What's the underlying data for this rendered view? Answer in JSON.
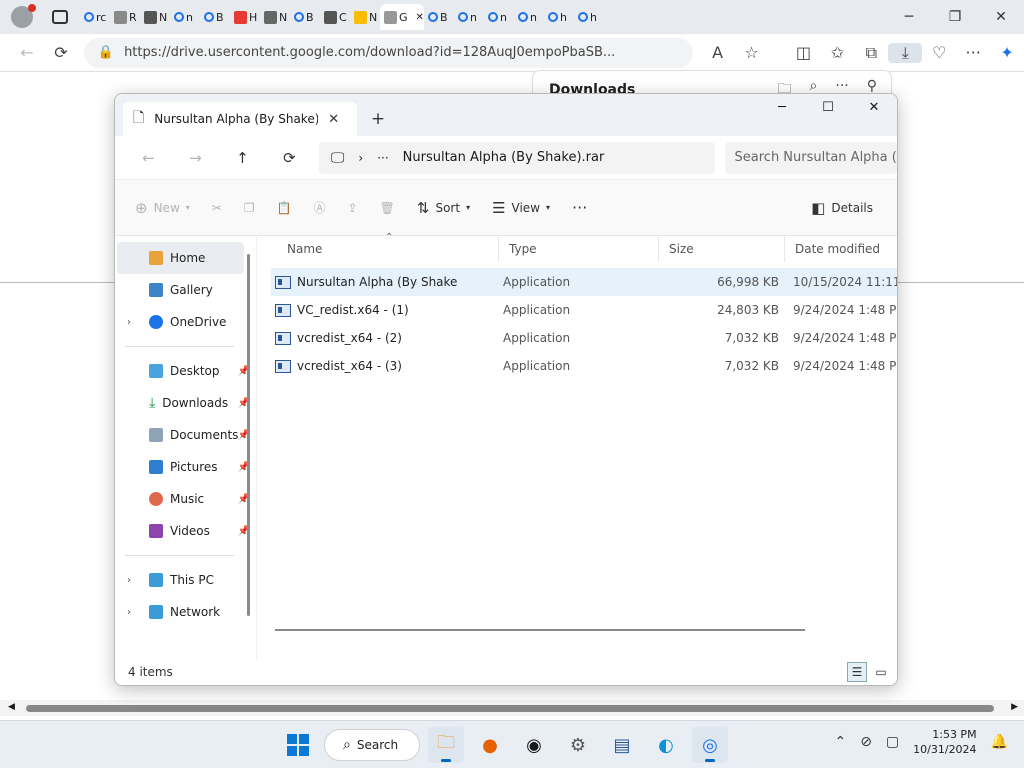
{
  "browser": {
    "tabs": [
      {
        "title": "rc",
        "icon": "search-icon"
      },
      {
        "title": "R",
        "icon": "image-icon"
      },
      {
        "title": "N",
        "icon": "news-icon"
      },
      {
        "title": "n",
        "icon": "search-icon"
      },
      {
        "title": "B",
        "icon": "search-icon"
      },
      {
        "title": "H",
        "icon": "youtube-icon"
      },
      {
        "title": "N",
        "icon": "document-icon"
      },
      {
        "title": "B",
        "icon": "search-icon"
      },
      {
        "title": "C",
        "icon": "speaker-icon"
      },
      {
        "title": "N",
        "icon": "google-drive-icon"
      },
      {
        "title": "G",
        "icon": "loading-icon",
        "active": true
      },
      {
        "title": "B",
        "icon": "search-icon"
      },
      {
        "title": "n",
        "icon": "search-icon"
      },
      {
        "title": "n",
        "icon": "search-icon"
      },
      {
        "title": "n",
        "icon": "search-icon"
      },
      {
        "title": "h",
        "icon": "search-icon"
      },
      {
        "title": "h",
        "icon": "search-icon"
      }
    ],
    "address_url": "https://drive.usercontent.google.com/download?id=128AuqJ0empoPbaSB...",
    "downloads_panel_title": "Downloads"
  },
  "explorer": {
    "tab_title": "Nursultan Alpha (By Shake).rar",
    "breadcrumb_more": "···",
    "breadcrumb_path": "Nursultan Alpha (By Shake).rar",
    "search_placeholder": "Search Nursultan Alpha (",
    "commands": {
      "new": "New",
      "sort": "Sort",
      "view": "View",
      "more": "···",
      "details": "Details"
    },
    "columns": {
      "name": "Name",
      "type": "Type",
      "size": "Size",
      "date": "Date modified"
    },
    "files": [
      {
        "name": "Nursultan Alpha (By Shake",
        "type": "Application",
        "size": "66,998 KB",
        "date": "10/15/2024 11:11"
      },
      {
        "name": "VC_redist.x64 - (1)",
        "type": "Application",
        "size": "24,803 KB",
        "date": "9/24/2024 1:48 PM"
      },
      {
        "name": "vcredist_x64  - (2)",
        "type": "Application",
        "size": "7,032 KB",
        "date": "9/24/2024 1:48 PM"
      },
      {
        "name": "vcredist_x64 - (3)",
        "type": "Application",
        "size": "7,032 KB",
        "date": "9/24/2024 1:48 PM"
      }
    ],
    "nav": {
      "home": "Home",
      "gallery": "Gallery",
      "onedrive": "OneDrive",
      "desktop": "Desktop",
      "downloads": "Downloads",
      "documents": "Documents",
      "pictures": "Pictures",
      "music": "Music",
      "videos": "Videos",
      "thispc": "This PC",
      "network": "Network"
    },
    "status": "4 items"
  },
  "taskbar": {
    "search_label": "Search",
    "time": "1:53 PM",
    "date": "10/31/2024"
  },
  "colors": {
    "accent": "#0067c0",
    "selection": "#e5f1fb"
  }
}
